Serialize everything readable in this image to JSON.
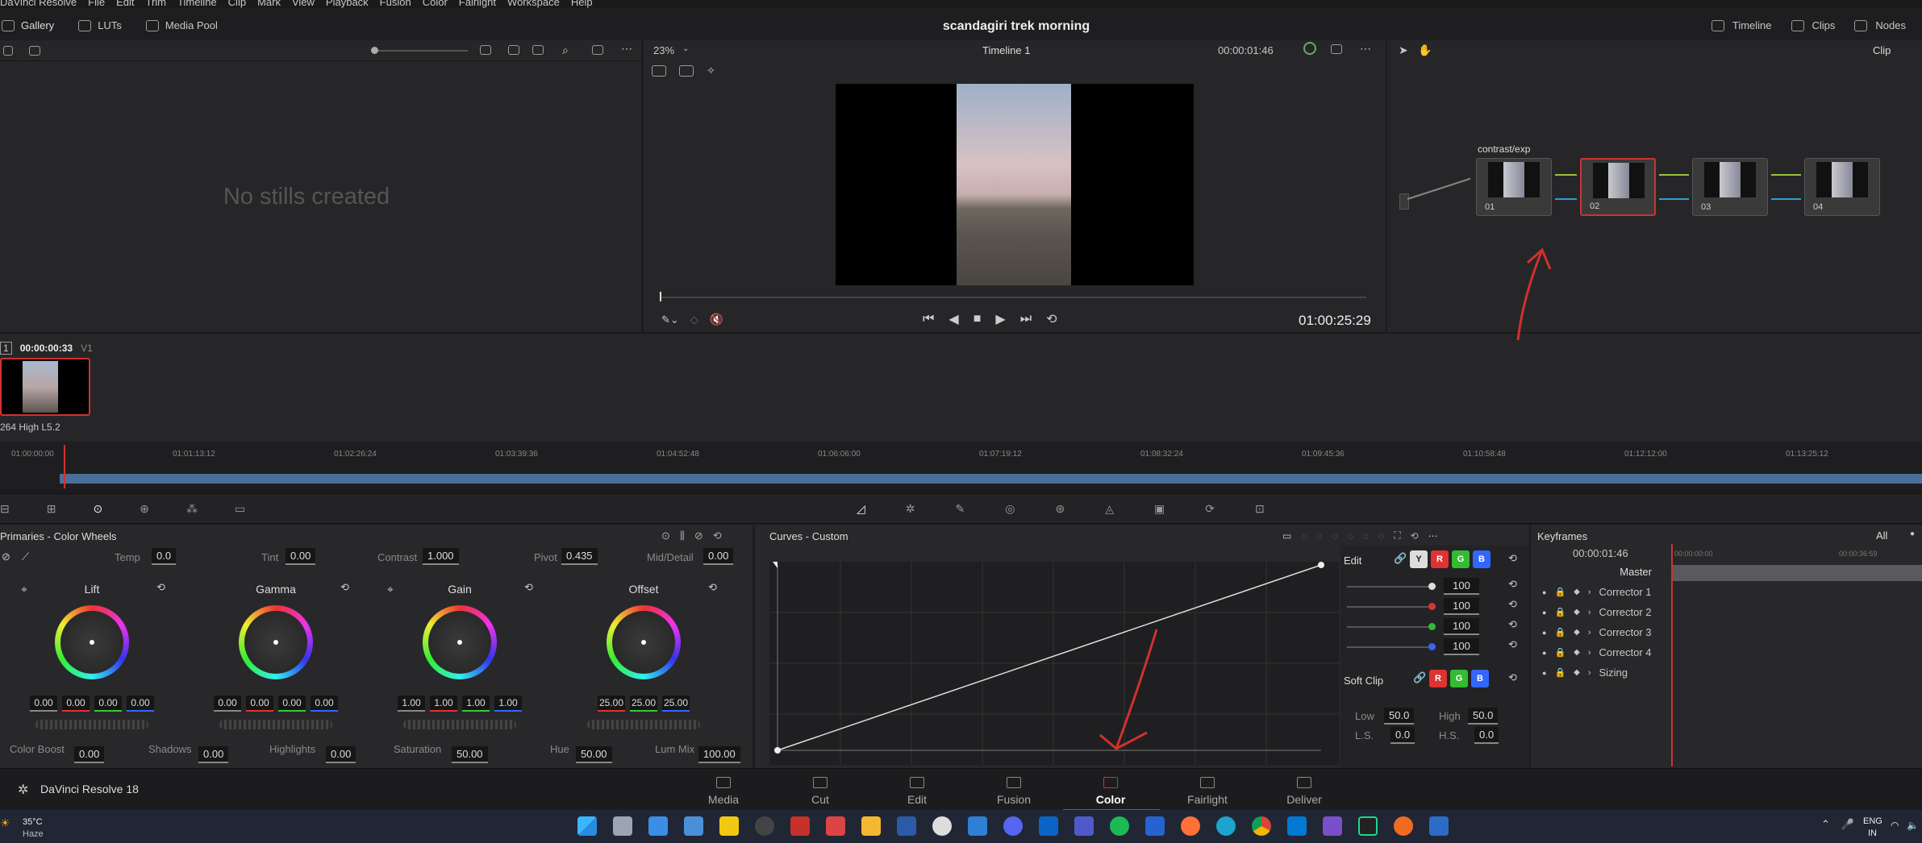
{
  "menu": [
    "DaVinci Resolve",
    "File",
    "Edit",
    "Trim",
    "Timeline",
    "Clip",
    "Mark",
    "View",
    "Playback",
    "Fusion",
    "Color",
    "Fairlight",
    "Workspace",
    "Help"
  ],
  "project_title": "scandagiri trek morning",
  "top_right": {
    "timeline": "Timeline",
    "clips": "Clips",
    "nodes": "Nodes"
  },
  "left_tabs": {
    "gallery": "Gallery",
    "luts": "LUTs",
    "media_pool": "Media Pool"
  },
  "gallery_empty": "No stills created",
  "viewer": {
    "zoom": "23%",
    "timeline_name": "Timeline 1",
    "timecode": "00:00:01:46",
    "playhead_tc": "01:00:25:29"
  },
  "node_panel": {
    "mode": "Clip",
    "node_label": "contrast/exp",
    "nodes": [
      "01",
      "02",
      "03",
      "04"
    ],
    "selected": "02"
  },
  "clip": {
    "index": "1",
    "tc": "00:00:00:33",
    "track": "V1",
    "codec": "264 High L5.2"
  },
  "ruler": [
    "01:00:00:00",
    "01:01:13:12",
    "01:02:26:24",
    "01:03:39:36",
    "01:04:52:48",
    "01:06:06:00",
    "01:07:19:12",
    "01:08:32:24",
    "01:09:45:36",
    "01:10:58:48",
    "01:12:12:00",
    "01:13:25:12"
  ],
  "primaries": {
    "title": "Primaries - Color Wheels",
    "temp_label": "Temp",
    "temp": "0.0",
    "tint_label": "Tint",
    "tint": "0.00",
    "contrast_label": "Contrast",
    "contrast": "1.000",
    "pivot_label": "Pivot",
    "pivot": "0.435",
    "md_label": "Mid/Detail",
    "md": "0.00",
    "wheels": [
      {
        "name": "Lift",
        "vals": [
          "0.00",
          "0.00",
          "0.00",
          "0.00"
        ]
      },
      {
        "name": "Gamma",
        "vals": [
          "0.00",
          "0.00",
          "0.00",
          "0.00"
        ]
      },
      {
        "name": "Gain",
        "vals": [
          "1.00",
          "1.00",
          "1.00",
          "1.00"
        ]
      },
      {
        "name": "Offset",
        "vals": [
          "25.00",
          "25.00",
          "25.00"
        ]
      }
    ],
    "cb_label": "Color Boost",
    "cb": "0.00",
    "sh_label": "Shadows",
    "sh": "0.00",
    "hl_label": "Highlights",
    "hl": "0.00",
    "sat_label": "Saturation",
    "sat": "50.00",
    "hue_label": "Hue",
    "hue": "50.00",
    "lm_label": "Lum Mix",
    "lm": "100.00"
  },
  "curves": {
    "title": "Curves - Custom",
    "edit": "Edit",
    "channels": [
      "Y",
      "R",
      "G",
      "B"
    ],
    "values": [
      "100",
      "100",
      "100",
      "100"
    ],
    "soft_clip": "Soft Clip",
    "low_label": "Low",
    "low": "50.0",
    "high_label": "High",
    "high": "50.0",
    "ls_label": "L.S.",
    "ls": "0.0",
    "hs_label": "H.S.",
    "hs": "0.0"
  },
  "keyframes": {
    "title": "Keyframes",
    "filter": "All",
    "tc": "00:00:01:46",
    "tc_start": "00:00:00:00",
    "tc_end": "00:00:36:59",
    "rows": [
      "Master",
      "Corrector 1",
      "Corrector 2",
      "Corrector 3",
      "Corrector 4",
      "Sizing"
    ]
  },
  "pages": [
    "Media",
    "Cut",
    "Edit",
    "Fusion",
    "Color",
    "Fairlight",
    "Deliver"
  ],
  "active_page": "Color",
  "app_name": "DaVinci Resolve 18",
  "taskbar": {
    "temp": "35°C",
    "weather": "Haze",
    "lang1": "ENG",
    "lang2": "IN"
  },
  "colors": {
    "accent_red": "#d0312d",
    "bg": "#1c1c1e",
    "panel": "#28282a"
  }
}
